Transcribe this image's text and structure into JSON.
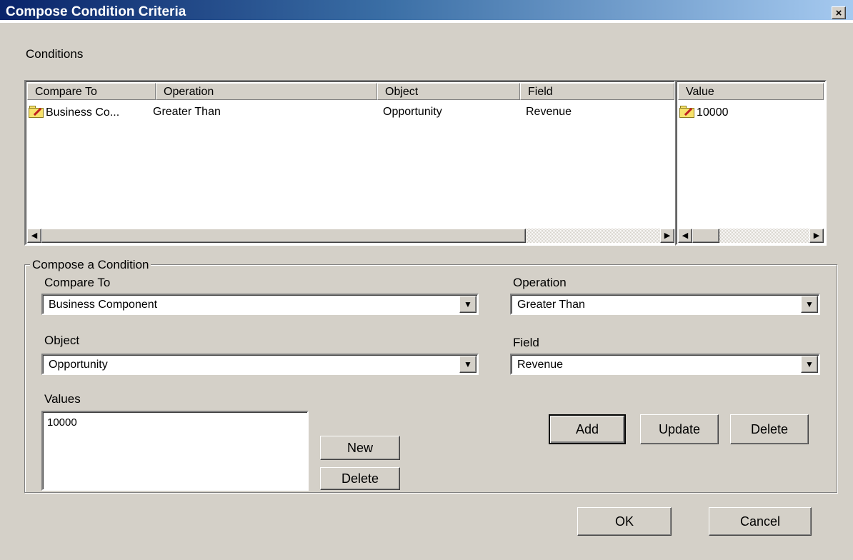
{
  "window": {
    "title": "Compose Condition Criteria",
    "close_glyph": "×"
  },
  "conditions": {
    "label": "Conditions",
    "columns": [
      "Compare To",
      "Operation",
      "Object",
      "Field",
      "Value"
    ],
    "rows": [
      {
        "compare_to": "Business Co...",
        "operation": "Greater Than",
        "object": "Opportunity",
        "field": "Revenue",
        "value": "10000"
      }
    ]
  },
  "compose": {
    "legend": "Compose a Condition",
    "compare_to": {
      "label": "Compare To",
      "value": "Business Component"
    },
    "operation": {
      "label": "Operation",
      "value": "Greater Than"
    },
    "object": {
      "label": "Object",
      "value": "Opportunity"
    },
    "field": {
      "label": "Field",
      "value": "Revenue"
    },
    "values": {
      "label": "Values",
      "text": "10000"
    },
    "buttons": {
      "new": "New",
      "delete_value": "Delete",
      "add": "Add",
      "update": "Update",
      "delete": "Delete"
    }
  },
  "footer": {
    "ok": "OK",
    "cancel": "Cancel"
  },
  "icons": {
    "row_icon": "folder-edit-icon",
    "dropdown": "chevron-down-icon",
    "scroll_left": "arrow-left-icon",
    "scroll_right": "arrow-right-icon"
  }
}
